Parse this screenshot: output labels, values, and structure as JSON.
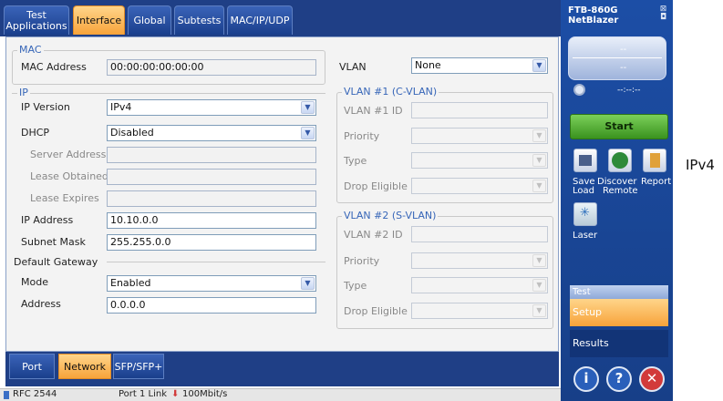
{
  "tabs": [
    "Test Applications",
    "Interface",
    "Global",
    "Subtests",
    "MAC/IP/UDP"
  ],
  "mac": {
    "section": "MAC",
    "label": "MAC Address",
    "value": "00:00:00:00:00:00"
  },
  "ip": {
    "section": "IP",
    "version_label": "IP Version",
    "version_value": "IPv4",
    "dhcp_label": "DHCP",
    "dhcp_value": "Disabled",
    "server_label": "Server Address",
    "lease_obtained_label": "Lease Obtained",
    "lease_expires_label": "Lease Expires",
    "address_label": "IP Address",
    "address_value": "10.10.0.0",
    "mask_label": "Subnet Mask",
    "mask_value": "255.255.0.0"
  },
  "gateway": {
    "section": "Default Gateway",
    "mode_label": "Mode",
    "mode_value": "Enabled",
    "address_label": "Address",
    "address_value": "0.0.0.0"
  },
  "vlan": {
    "label": "VLAN",
    "value": "None",
    "c_section": "VLAN #1 (C-VLAN)",
    "c_id_label": "VLAN #1 ID",
    "s_section": "VLAN #2 (S-VLAN)",
    "s_id_label": "VLAN #2 ID",
    "priority_label": "Priority",
    "type_label": "Type",
    "drop_label": "Drop Eligible"
  },
  "bottom_tabs": [
    "Port",
    "Network",
    "SFP/SFP+"
  ],
  "status": {
    "rfc": "RFC 2544",
    "link": "Port 1 Link",
    "speed": "100Mbit/s"
  },
  "sidebar": {
    "model": "FTB-860G",
    "product": "NetBlazer",
    "display_top": "--",
    "display_bottom": "--",
    "timer": "--:--:--",
    "start": "Start",
    "save_line1": "Save",
    "save_line2": "Load",
    "discover_line1": "Discover",
    "discover_line2": "Remote",
    "report": "Report",
    "laser": "Laser",
    "test_header": "Test",
    "setup": "Setup",
    "results": "Results",
    "info_glyph": "i",
    "help_glyph": "?",
    "close_glyph": "✕"
  },
  "annotation": "IPv4",
  "colors": {
    "accent": "#f7a33a",
    "brand": "#1f3f86",
    "start": "#4aa82a",
    "close": "#d23a3a"
  }
}
